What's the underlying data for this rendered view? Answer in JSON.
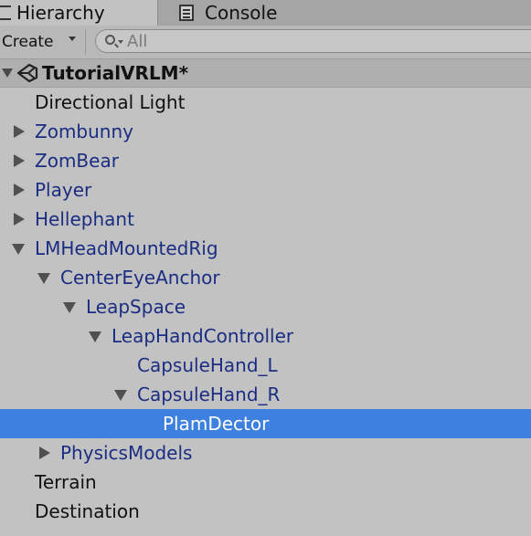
{
  "tabs": {
    "hierarchy_label": "Hierarchy",
    "console_label": "Console"
  },
  "toolbar": {
    "create_label": "Create",
    "search_placeholder": "All"
  },
  "scene": {
    "title": "TutorialVRLM*"
  },
  "tree": {
    "items": [
      {
        "label": "Directional Light",
        "depth": 0,
        "expander": "none",
        "type": "plain"
      },
      {
        "label": "Zombunny",
        "depth": 0,
        "expander": "collapsed",
        "type": "prefab"
      },
      {
        "label": "ZomBear",
        "depth": 0,
        "expander": "collapsed",
        "type": "prefab"
      },
      {
        "label": "Player",
        "depth": 0,
        "expander": "collapsed",
        "type": "prefab"
      },
      {
        "label": "Hellephant",
        "depth": 0,
        "expander": "collapsed",
        "type": "prefab"
      },
      {
        "label": "LMHeadMountedRig",
        "depth": 0,
        "expander": "expanded",
        "type": "prefab"
      },
      {
        "label": "CenterEyeAnchor",
        "depth": 1,
        "expander": "expanded",
        "type": "prefab"
      },
      {
        "label": "LeapSpace",
        "depth": 2,
        "expander": "expanded",
        "type": "prefab"
      },
      {
        "label": "LeapHandController",
        "depth": 3,
        "expander": "expanded",
        "type": "prefab"
      },
      {
        "label": "CapsuleHand_L",
        "depth": 4,
        "expander": "none",
        "type": "prefab"
      },
      {
        "label": "CapsuleHand_R",
        "depth": 4,
        "expander": "expanded",
        "type": "prefab"
      },
      {
        "label": "PlamDector",
        "depth": 5,
        "expander": "none",
        "type": "prefab",
        "selected": true
      },
      {
        "label": "PhysicsModels",
        "depth": 1,
        "expander": "collapsed",
        "type": "prefab"
      },
      {
        "label": "Terrain",
        "depth": 0,
        "expander": "none",
        "type": "plain"
      },
      {
        "label": "Destination",
        "depth": 0,
        "expander": "none",
        "type": "plain"
      }
    ]
  },
  "colors": {
    "panel_bg": "#c2c2c2",
    "selection": "#3d80df",
    "prefab_text": "#1a2d82"
  }
}
